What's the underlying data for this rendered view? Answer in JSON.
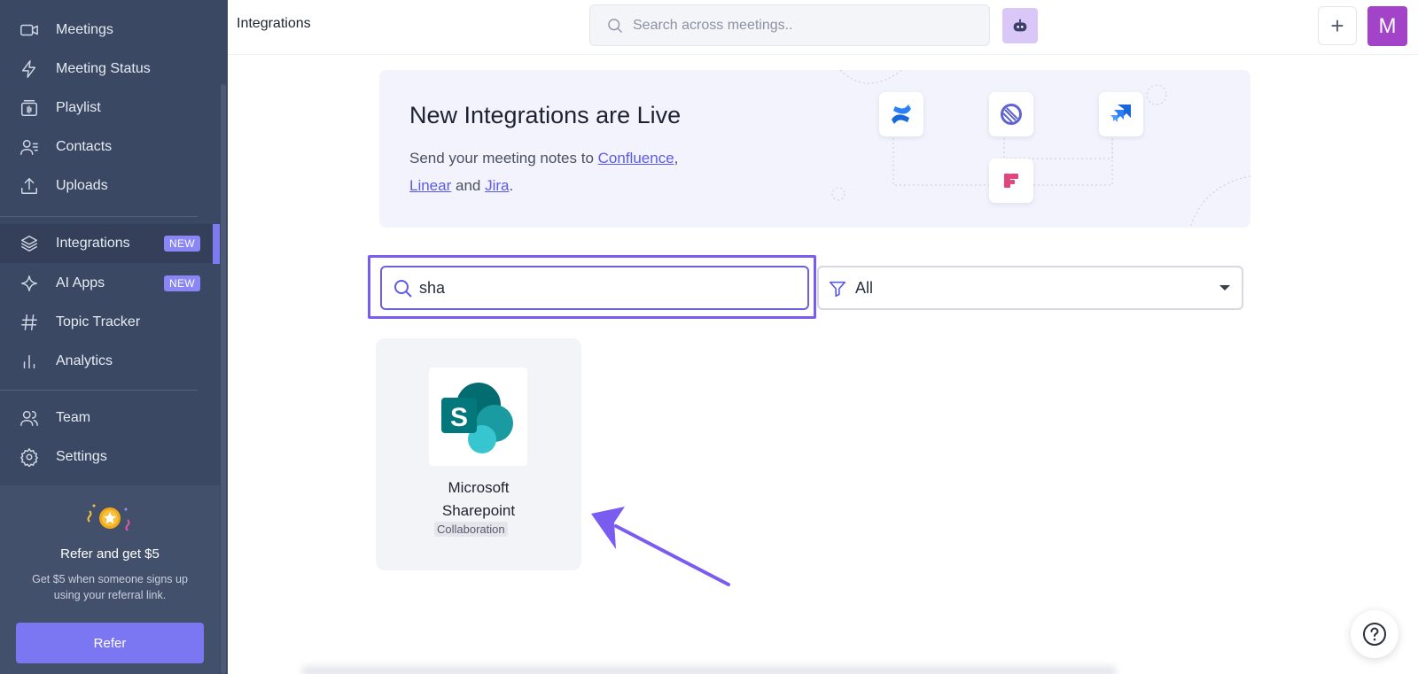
{
  "sidebar": {
    "items": [
      {
        "label": "Meetings",
        "icon": "video-camera-icon"
      },
      {
        "label": "Meeting Status",
        "icon": "lightning-icon"
      },
      {
        "label": "Playlist",
        "icon": "playlist-icon"
      },
      {
        "label": "Contacts",
        "icon": "contacts-icon"
      },
      {
        "label": "Uploads",
        "icon": "upload-icon"
      },
      {
        "label": "Integrations",
        "icon": "layers-icon",
        "badge": "NEW",
        "active": true
      },
      {
        "label": "AI Apps",
        "icon": "sparkle-icon",
        "badge": "NEW"
      },
      {
        "label": "Topic Tracker",
        "icon": "hashtag-icon"
      },
      {
        "label": "Analytics",
        "icon": "bar-chart-icon"
      },
      {
        "label": "Team",
        "icon": "team-icon"
      },
      {
        "label": "Settings",
        "icon": "gear-icon"
      }
    ],
    "refer": {
      "title": "Refer and get $5",
      "description": "Get $5 when someone signs up using your referral link.",
      "button": "Refer"
    }
  },
  "header": {
    "title": "Integrations",
    "search_placeholder": "Search across meetings..",
    "avatar_initial": "M"
  },
  "banner": {
    "title": "New Integrations are Live",
    "text_prefix": "Send your meeting notes to ",
    "link_confluence": "Confluence",
    "comma": ",",
    "link_linear": "Linear",
    "and": " and ",
    "link_jira": "Jira",
    "period": ".",
    "logos": [
      "confluence-icon",
      "linear-icon",
      "jira-icon",
      "frame-icon"
    ]
  },
  "filters": {
    "search_value": "sha",
    "category_value": "All"
  },
  "results": [
    {
      "name_line1": "Microsoft",
      "name_line2": "Sharepoint",
      "category": "Collaboration",
      "icon": "sharepoint-icon"
    }
  ],
  "colors": {
    "sidebar_bg": "#3a4863",
    "accent": "#7b76f2",
    "highlight": "#7a5cf0",
    "link": "#5b5be8"
  }
}
